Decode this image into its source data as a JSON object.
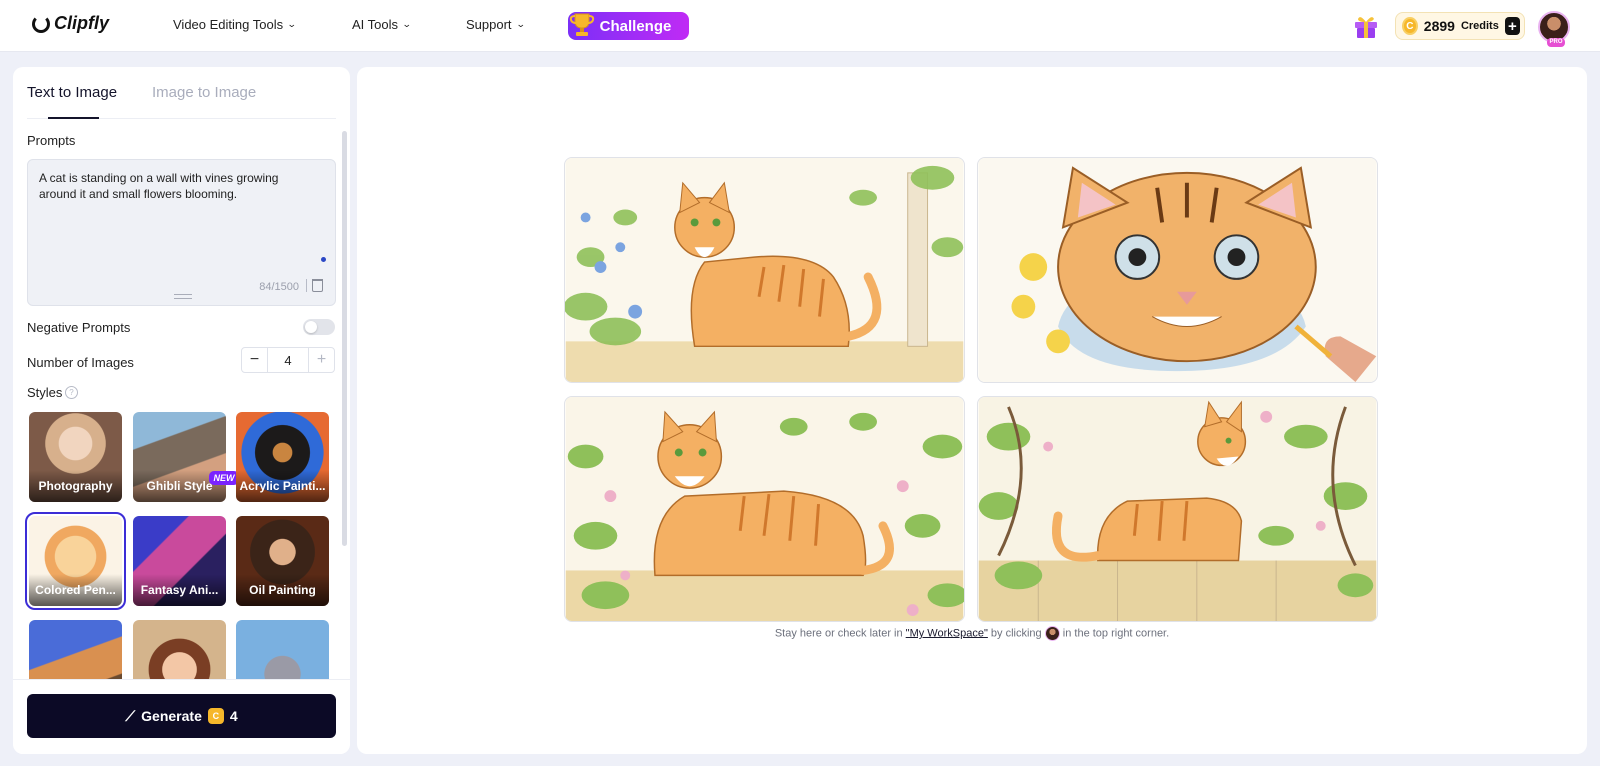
{
  "app": {
    "brand": "Clipfly"
  },
  "nav": {
    "items": [
      {
        "label": "Video Editing Tools"
      },
      {
        "label": "AI Tools"
      },
      {
        "label": "Support"
      }
    ],
    "challenge_label": "Challenge"
  },
  "account": {
    "credits_value": "2899",
    "credits_label": "Credits",
    "avatar_badge": "PRO"
  },
  "sidebar": {
    "tabs": [
      {
        "label": "Text to Image",
        "active": true
      },
      {
        "label": "Image to Image",
        "active": false
      }
    ],
    "prompts_label": "Prompts",
    "prompt_value": "A cat is standing on a wall with vines growing around it and small flowers blooming.",
    "char_count": "84/1500",
    "negative_prompts_label": "Negative Prompts",
    "negative_prompts_enabled": false,
    "num_images_label": "Number of Images",
    "num_images_value": "4",
    "styles_label": "Styles",
    "new_badge": "NEW",
    "styles": [
      {
        "label": "Photography",
        "selected": false
      },
      {
        "label": "Ghibli Style",
        "selected": false
      },
      {
        "label": "Acrylic Painti...",
        "selected": false
      },
      {
        "label": "Colored Pen...",
        "selected": true
      },
      {
        "label": "Fantasy Ani...",
        "selected": false
      },
      {
        "label": "Oil Painting",
        "selected": false
      },
      {
        "label": "",
        "selected": false
      },
      {
        "label": "",
        "selected": false
      },
      {
        "label": "",
        "selected": false
      }
    ],
    "generate_label": "Generate",
    "generate_cost": "4"
  },
  "main": {
    "hint_prefix": "Stay here or check later in ",
    "hint_link": "\"My WorkSpace\"",
    "hint_middle": " by clicking ",
    "hint_suffix": " in the top right corner.",
    "images": [
      {
        "name": "generated-image-1"
      },
      {
        "name": "generated-image-2"
      },
      {
        "name": "generated-image-3"
      },
      {
        "name": "generated-image-4"
      }
    ]
  },
  "colors": {
    "accent": "#3c2dd6",
    "challenge_gradient_start": "#7b2ff7",
    "challenge_gradient_end": "#c02bf5",
    "generate_bg": "#0c0a26",
    "coin": "#f6b72a"
  }
}
